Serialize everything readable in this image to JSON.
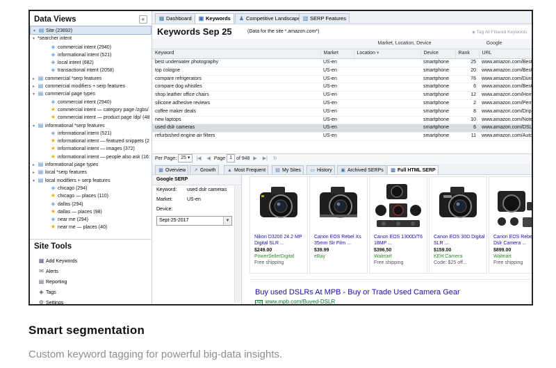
{
  "left_panel": {
    "title": "Data Views",
    "collapse_symbol": "«",
    "tree": [
      {
        "label": "Site (23692)",
        "icon": "folder-icon",
        "level": 0,
        "twisty": "▾",
        "selected": true
      },
      {
        "label": "*searcher intent",
        "icon": "none",
        "level": 0,
        "twisty": "▾"
      },
      {
        "label": "commercial intent (2940)",
        "icon": "tag-icon",
        "level": 2
      },
      {
        "label": "informational intent (521)",
        "icon": "tag-icon",
        "level": 2
      },
      {
        "label": "local intent (682)",
        "icon": "tag-icon",
        "level": 2
      },
      {
        "label": "transactional intent (2058)",
        "icon": "tag-icon",
        "level": 2
      },
      {
        "label": "commercial *serp features",
        "icon": "folder-icon",
        "level": 0,
        "twisty": "▸"
      },
      {
        "label": "commercial modifiers + serp features",
        "icon": "folder-icon",
        "level": 0,
        "twisty": "▸"
      },
      {
        "label": "commercial page types",
        "icon": "folder-icon",
        "level": 0,
        "twisty": "▾"
      },
      {
        "label": "commercial intent (2940)",
        "icon": "tag-icon",
        "level": 2
      },
      {
        "label": "commercial intent — category page /zgbs/",
        "icon": "star-icon",
        "level": 2
      },
      {
        "label": "commercial intent — product page /dp/ (48",
        "icon": "star-icon",
        "level": 2
      },
      {
        "label": "informational *serp features",
        "icon": "folder-icon",
        "level": 0,
        "twisty": "▾"
      },
      {
        "label": "informational intent (521)",
        "icon": "tag-icon",
        "level": 2
      },
      {
        "label": "informational intent — featured snippets (2",
        "icon": "star-icon",
        "level": 2
      },
      {
        "label": "informational intent — images (372)",
        "icon": "star-icon",
        "level": 2
      },
      {
        "label": "informational intent — people also ask (16:",
        "icon": "star-icon",
        "level": 2
      },
      {
        "label": "informational page types",
        "icon": "folder-icon",
        "level": 0,
        "twisty": "▸"
      },
      {
        "label": "local *serp features",
        "icon": "folder-icon",
        "level": 0,
        "twisty": "▸"
      },
      {
        "label": "local modifiers + serp features",
        "icon": "folder-icon",
        "level": 0,
        "twisty": "▾"
      },
      {
        "label": "chicago (294)",
        "icon": "tag-icon",
        "level": 2
      },
      {
        "label": "chicago — places (110)",
        "icon": "star-icon",
        "level": 2
      },
      {
        "label": "dallas (294)",
        "icon": "tag-icon",
        "level": 2
      },
      {
        "label": "dallas — places (98)",
        "icon": "star-icon",
        "level": 2
      },
      {
        "label": "near me (294)",
        "icon": "tag-icon",
        "level": 2
      },
      {
        "label": "near me — places (40)",
        "icon": "star-icon",
        "level": 2
      }
    ],
    "site_tools_title": "Site Tools",
    "tools": [
      {
        "label": "Add Keywords",
        "icon": "add-keywords-icon",
        "glyph": "▦"
      },
      {
        "label": "Alerts",
        "icon": "alerts-icon",
        "glyph": "✉"
      },
      {
        "label": "Reporting",
        "icon": "reporting-icon",
        "glyph": "▤"
      },
      {
        "label": "Tags",
        "icon": "tags-icon",
        "glyph": "◈"
      },
      {
        "label": "Settings",
        "icon": "settings-icon",
        "glyph": "⚙"
      }
    ]
  },
  "top_tabs": [
    {
      "label": "Dashboard",
      "icon": "dashboard-icon",
      "glyph": "▦",
      "active": false
    },
    {
      "label": "Keywords",
      "icon": "keywords-icon",
      "glyph": "▣",
      "active": true
    },
    {
      "label": "Competitive Landscape",
      "icon": "competitive-icon",
      "glyph": "♟",
      "active": false
    },
    {
      "label": "SERP Features",
      "icon": "serp-features-icon",
      "glyph": "▥",
      "active": false
    }
  ],
  "header": {
    "title": "Keywords  Sep 25",
    "subtitle": "(Data for the site *.amazon.com*)",
    "tag_all": "Tag All Filtered Keywords"
  },
  "table": {
    "group_headers": [
      "Market, Location, Device",
      "Google"
    ],
    "columns": [
      "Keyword",
      "Market",
      "Location",
      "Device",
      "Rank",
      "URL"
    ],
    "location_sort": "▾",
    "rows": [
      {
        "keyword": "best underwater photography",
        "market": "US-en",
        "location": "",
        "device": "smartphone",
        "rank": "25",
        "url": "www.amazon.com/Best-"
      },
      {
        "keyword": "top cologne",
        "market": "US-en",
        "location": "",
        "device": "smartphone",
        "rank": "20",
        "url": "www.amazon.com/Best-"
      },
      {
        "keyword": "compare refrigerators",
        "market": "US-en",
        "location": "",
        "device": "smartphone",
        "rank": "76",
        "url": "www.amazon.com/Dura-"
      },
      {
        "keyword": "compare dog whistles",
        "market": "US-en",
        "location": "",
        "device": "smartphone",
        "rank": "6",
        "url": "www.amazon.com/Best-"
      },
      {
        "keyword": "shop leather office chairs",
        "market": "US-en",
        "location": "",
        "device": "smartphone",
        "rank": "12",
        "url": "www.amazon.com/Home-"
      },
      {
        "keyword": "silicone adhesive reviews",
        "market": "US-en",
        "location": "",
        "device": "smartphone",
        "rank": "2",
        "url": "www.amazon.com/Perm-"
      },
      {
        "keyword": "coffee maker deals",
        "market": "US-en",
        "location": "",
        "device": "smartphone",
        "rank": "8",
        "url": "www.amazon.com/Drip-"
      },
      {
        "keyword": "new laptops",
        "market": "US-en",
        "location": "",
        "device": "smartphone",
        "rank": "10",
        "url": "www.amazon.com/Note-"
      },
      {
        "keyword": "used dslr cameras",
        "market": "US-en",
        "location": "",
        "device": "smartphone",
        "rank": "6",
        "url": "www.amazon.com/DSL-",
        "highlight": true
      },
      {
        "keyword": "refurbished engine air filters",
        "market": "US-en",
        "location": "",
        "device": "smartphone",
        "rank": "11",
        "url": "www.amazon.com/Auto-"
      }
    ]
  },
  "pager": {
    "per_page_label": "Per Page:",
    "per_page_value": "25",
    "page_label": "Page",
    "page_value": "1",
    "of_label": "of 948"
  },
  "bottom_tabs": [
    {
      "label": "Overview",
      "icon": "overview-icon",
      "glyph": "▦",
      "active": false
    },
    {
      "label": "Growth",
      "icon": "growth-icon",
      "glyph": "↗",
      "active": false
    },
    {
      "label": "Most Frequent",
      "icon": "most-frequent-icon",
      "glyph": "▲",
      "active": false
    },
    {
      "label": "My Sites",
      "icon": "my-sites-icon",
      "glyph": "▤",
      "active": false
    },
    {
      "label": "History",
      "icon": "history-icon",
      "glyph": "▭",
      "active": false
    },
    {
      "label": "Archived SERPs",
      "icon": "archived-serps-icon",
      "glyph": "▣",
      "active": false
    },
    {
      "label": "Full HTML SERP",
      "icon": "full-html-serp-icon",
      "glyph": "▥",
      "active": true
    }
  ],
  "google_serp": {
    "title": "Google SERP",
    "keyword_label": "Keyword:",
    "keyword_value": "used dslr cameras",
    "market_label": "Market:",
    "market_value": "US-en",
    "device_label": "Device:",
    "date_value": "Sept-25-2017"
  },
  "products": [
    {
      "title": "Nikon D3200 24.2 MP Digital SLR ...",
      "price": "$249.00",
      "merchant": "PowerSellerDigital",
      "shipping": "Free shipping"
    },
    {
      "title": "Canon EOS Rebel Xs 35mm Slr Film ...",
      "price": "$39.99",
      "merchant": "eBay",
      "shipping": ""
    },
    {
      "title": "Canon EOS 1300D/T6 18MP ...",
      "price": "$396.50",
      "merchant": "Walmart",
      "shipping": "Free shipping"
    },
    {
      "title": "Canon EOS 30D Digital SLR ...",
      "price": "$159.00",
      "merchant": "KEH Camera",
      "shipping": "Code: $25 off..."
    },
    {
      "title": "Canon EOS Rebel T6i Dslr Camera ...",
      "price": "$899.00",
      "merchant": "Walmart",
      "shipping": "Free shipping"
    }
  ],
  "ad": {
    "title": "Buy used DSLRs At MPB - Buy or Trade Used Camera Gear",
    "badge": "Ad",
    "url": "www.mpb.com/Buyed-DSLR"
  },
  "caption": {
    "heading": "Smart segmentation",
    "subheading": "Custom keyword tagging for powerful big-data insights."
  },
  "colors": {
    "link": "#1a0dab",
    "url": "#2a63c9",
    "merchant": "#2b8a2b",
    "star": "#f0a800",
    "folder": "#4a86c5"
  }
}
